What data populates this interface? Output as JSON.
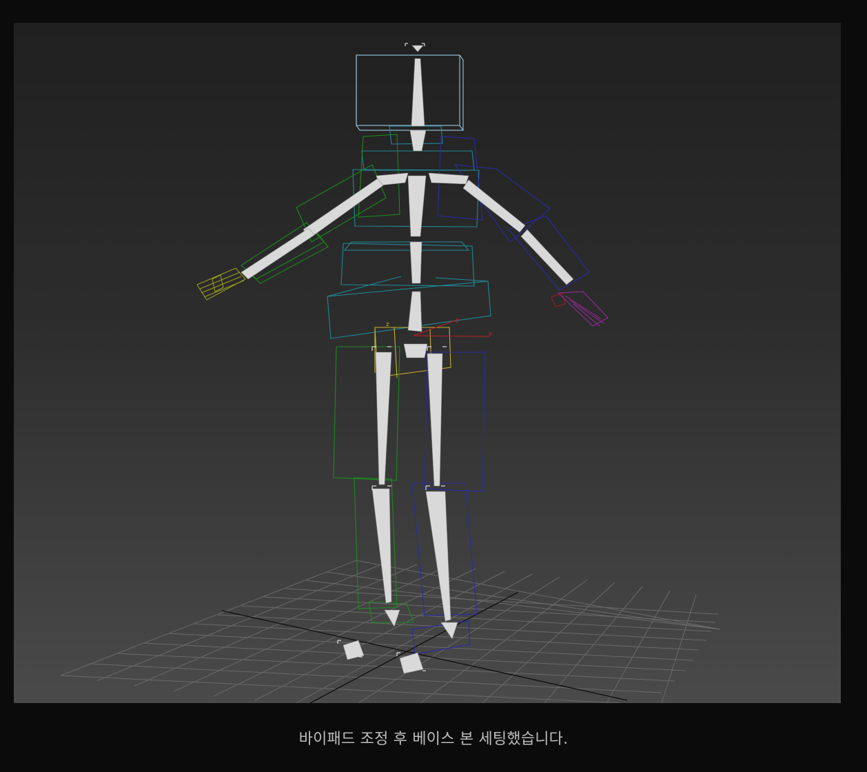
{
  "caption": "바이패드 조정 후 베이스 본 세팅했습니다.",
  "scene": {
    "subject": "biped-skeleton-rig",
    "axis_labels": [
      "x",
      "y",
      "z"
    ],
    "colors": {
      "background_top": "#202020",
      "background_bottom": "#4a4a4a",
      "bone_fill": "#d9d9d9",
      "head_box": "#8fb7cf",
      "spine_box": "#1f8a99",
      "left_side": "#1d8a1d",
      "right_side": "#2a2aa8",
      "pelvis": "#c8b030",
      "left_hand": "#9aa320",
      "right_hand": "#9a2aa0",
      "grid": "#6a6a6a",
      "grid_axis": "#111111",
      "axis_x": "#c02020"
    }
  }
}
